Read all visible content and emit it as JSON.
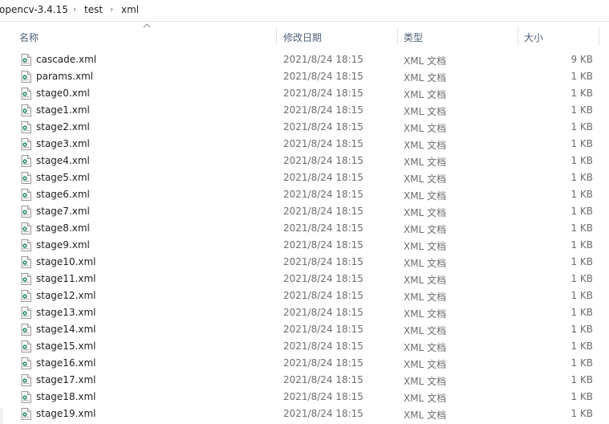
{
  "breadcrumb": [
    {
      "label": "opencv-3.4.15",
      "sep": "›"
    },
    {
      "label": "test",
      "sep": "›"
    },
    {
      "label": "xml",
      "sep": ""
    }
  ],
  "columns": {
    "name": "名称",
    "date": "修改日期",
    "type": "类型",
    "size": "大小"
  },
  "files": [
    {
      "name": "cascade.xml",
      "date": "2021/8/24 18:15",
      "type": "XML 文档",
      "size": "9 KB"
    },
    {
      "name": "params.xml",
      "date": "2021/8/24 18:15",
      "type": "XML 文档",
      "size": "1 KB"
    },
    {
      "name": "stage0.xml",
      "date": "2021/8/24 18:15",
      "type": "XML 文档",
      "size": "1 KB"
    },
    {
      "name": "stage1.xml",
      "date": "2021/8/24 18:15",
      "type": "XML 文档",
      "size": "1 KB"
    },
    {
      "name": "stage2.xml",
      "date": "2021/8/24 18:15",
      "type": "XML 文档",
      "size": "1 KB"
    },
    {
      "name": "stage3.xml",
      "date": "2021/8/24 18:15",
      "type": "XML 文档",
      "size": "1 KB"
    },
    {
      "name": "stage4.xml",
      "date": "2021/8/24 18:15",
      "type": "XML 文档",
      "size": "1 KB"
    },
    {
      "name": "stage5.xml",
      "date": "2021/8/24 18:15",
      "type": "XML 文档",
      "size": "1 KB"
    },
    {
      "name": "stage6.xml",
      "date": "2021/8/24 18:15",
      "type": "XML 文档",
      "size": "1 KB"
    },
    {
      "name": "stage7.xml",
      "date": "2021/8/24 18:15",
      "type": "XML 文档",
      "size": "1 KB"
    },
    {
      "name": "stage8.xml",
      "date": "2021/8/24 18:15",
      "type": "XML 文档",
      "size": "1 KB"
    },
    {
      "name": "stage9.xml",
      "date": "2021/8/24 18:15",
      "type": "XML 文档",
      "size": "1 KB"
    },
    {
      "name": "stage10.xml",
      "date": "2021/8/24 18:15",
      "type": "XML 文档",
      "size": "1 KB"
    },
    {
      "name": "stage11.xml",
      "date": "2021/8/24 18:15",
      "type": "XML 文档",
      "size": "1 KB"
    },
    {
      "name": "stage12.xml",
      "date": "2021/8/24 18:15",
      "type": "XML 文档",
      "size": "1 KB"
    },
    {
      "name": "stage13.xml",
      "date": "2021/8/24 18:15",
      "type": "XML 文档",
      "size": "1 KB"
    },
    {
      "name": "stage14.xml",
      "date": "2021/8/24 18:15",
      "type": "XML 文档",
      "size": "1 KB"
    },
    {
      "name": "stage15.xml",
      "date": "2021/8/24 18:15",
      "type": "XML 文档",
      "size": "1 KB"
    },
    {
      "name": "stage16.xml",
      "date": "2021/8/24 18:15",
      "type": "XML 文档",
      "size": "1 KB"
    },
    {
      "name": "stage17.xml",
      "date": "2021/8/24 18:15",
      "type": "XML 文档",
      "size": "1 KB"
    },
    {
      "name": "stage18.xml",
      "date": "2021/8/24 18:15",
      "type": "XML 文档",
      "size": "1 KB"
    },
    {
      "name": "stage19.xml",
      "date": "2021/8/24 18:15",
      "type": "XML 文档",
      "size": "1 KB"
    }
  ],
  "icons": {
    "file": "xml-document-icon",
    "sort": "sort-ascending-icon"
  },
  "colors": {
    "header_text": "#4c607a",
    "secondary_text": "#6d6d6d",
    "icon_accent": "#1f8a70"
  }
}
